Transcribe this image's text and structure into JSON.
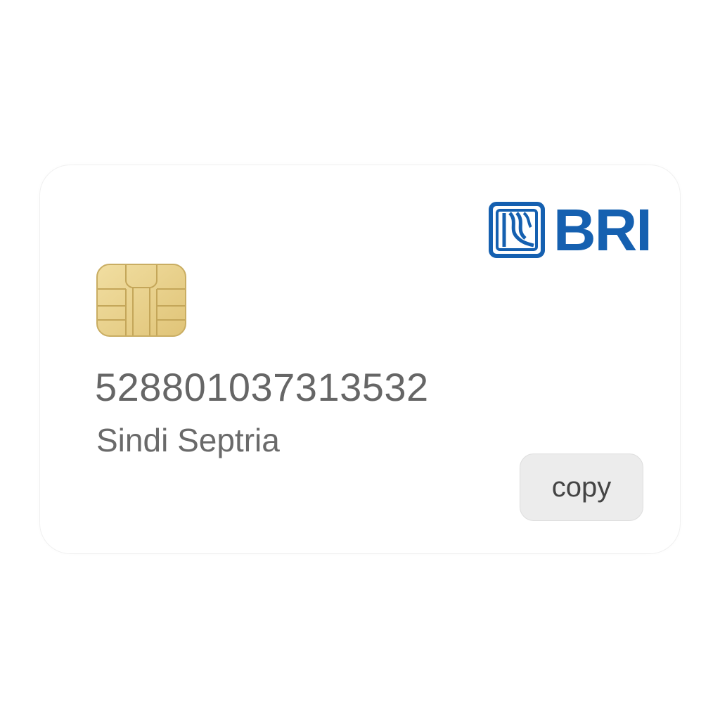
{
  "card": {
    "bank_logo": {
      "icon": "bri-logo-mark-icon",
      "text": "BRI",
      "color": "#1560b0"
    },
    "chip_icon": "emv-chip-icon",
    "card_number": "528801037313532",
    "holder_name": "Sindi Septria",
    "copy_label": "copy"
  }
}
